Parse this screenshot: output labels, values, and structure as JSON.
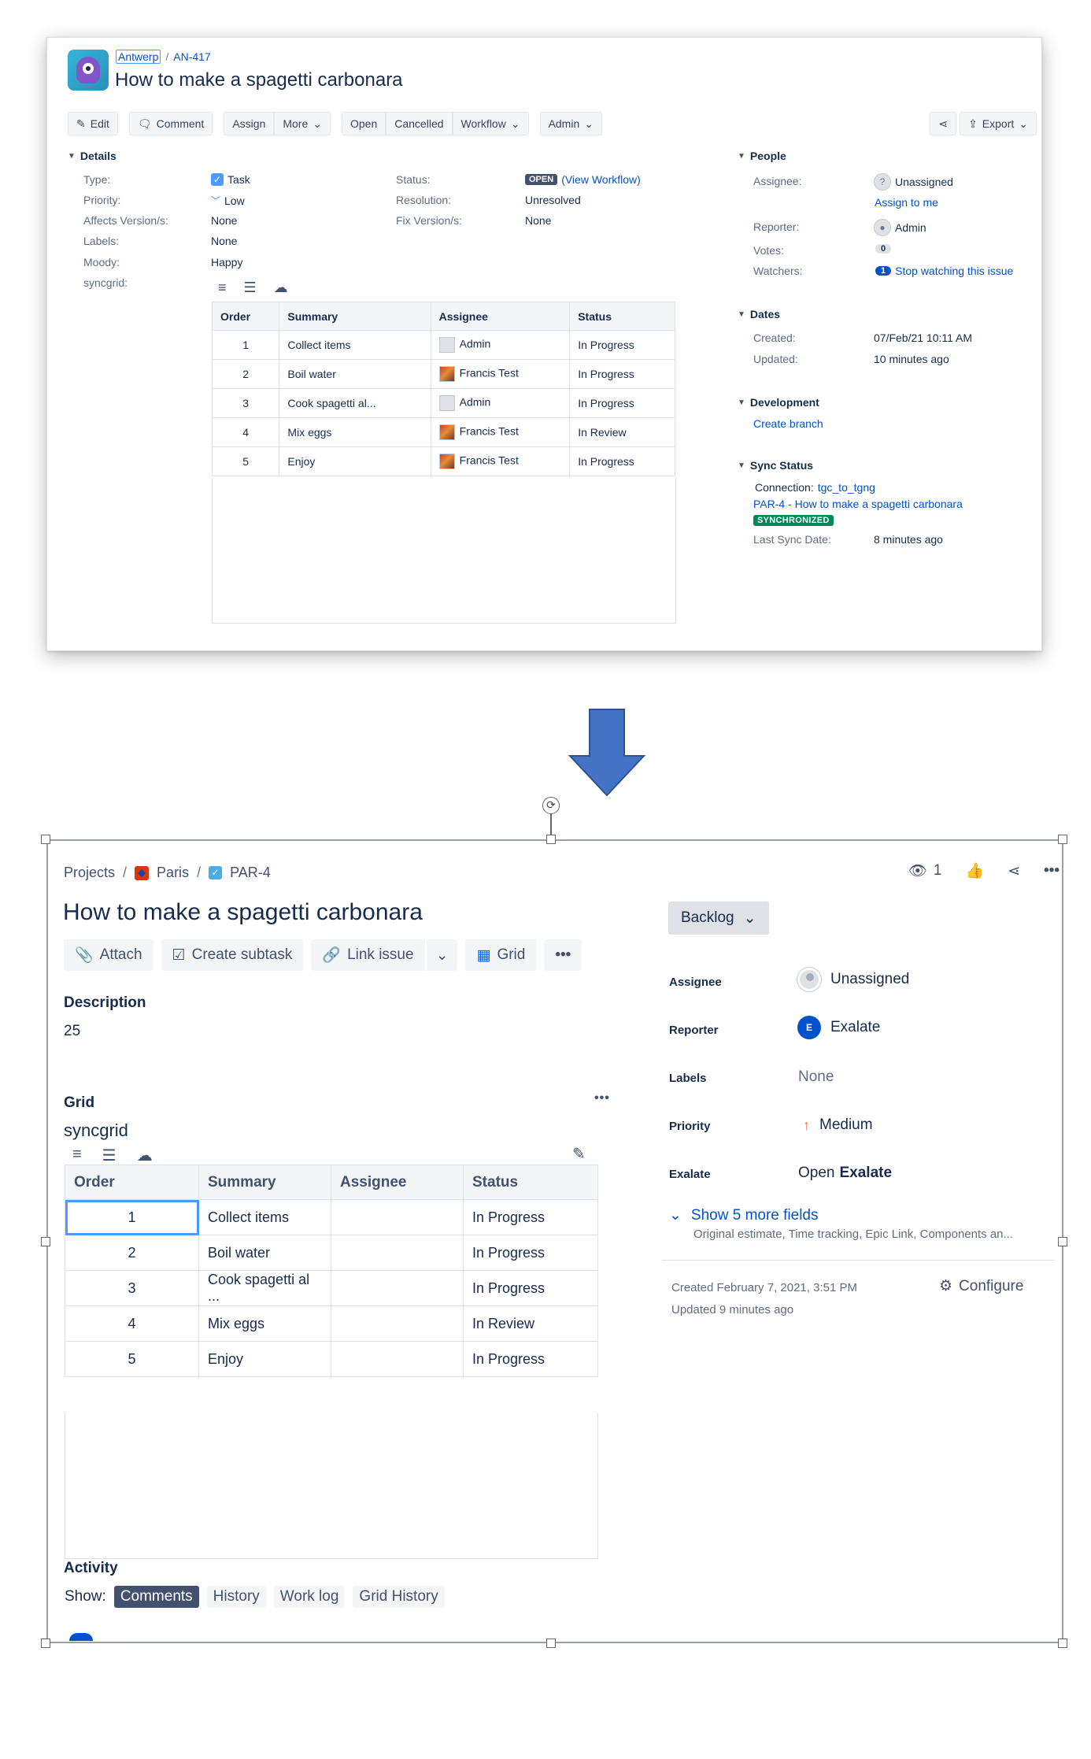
{
  "top": {
    "breadcrumb": {
      "project": "Antwerp",
      "issue_key": "AN-417"
    },
    "title": "How to make a spagetti carbonara",
    "toolbar": {
      "edit": "Edit",
      "comment": "Comment",
      "assign": "Assign",
      "more": "More",
      "open": "Open",
      "cancelled": "Cancelled",
      "workflow": "Workflow",
      "admin": "Admin",
      "export": "Export"
    },
    "details": {
      "heading": "Details",
      "type_label": "Type:",
      "type_value": "Task",
      "priority_label": "Priority:",
      "priority_value": "Low",
      "affects_label": "Affects Version/s:",
      "affects_value": "None",
      "labels_label": "Labels:",
      "labels_value": "None",
      "moody_label": "Moody:",
      "moody_value": "Happy",
      "syncgrid_label": "syncgrid:",
      "status_label": "Status:",
      "status_value": "OPEN",
      "view_workflow": "(View Workflow)",
      "resolution_label": "Resolution:",
      "resolution_value": "Unresolved",
      "fix_label": "Fix Version/s:",
      "fix_value": "None"
    },
    "grid": {
      "headers": [
        "Order",
        "Summary",
        "Assignee",
        "Status"
      ],
      "rows": [
        {
          "order": "1",
          "summary": "Collect items",
          "assignee": "Admin",
          "status": "In Progress"
        },
        {
          "order": "2",
          "summary": "Boil water",
          "assignee": "Francis Test",
          "status": "In Progress"
        },
        {
          "order": "3",
          "summary": "Cook spagetti al...",
          "assignee": "Admin",
          "status": "In Progress"
        },
        {
          "order": "4",
          "summary": "Mix eggs",
          "assignee": "Francis Test",
          "status": "In Review"
        },
        {
          "order": "5",
          "summary": "Enjoy",
          "assignee": "Francis Test",
          "status": "In Progress"
        }
      ]
    },
    "people": {
      "heading": "People",
      "assignee_label": "Assignee:",
      "assignee_value": "Unassigned",
      "assign_to_me": "Assign to me",
      "reporter_label": "Reporter:",
      "reporter_value": "Admin",
      "votes_label": "Votes:",
      "votes_value": "0",
      "watchers_label": "Watchers:",
      "watchers_count": "1",
      "watchers_link": "Stop watching this issue"
    },
    "dates": {
      "heading": "Dates",
      "created_label": "Created:",
      "created_value": "07/Feb/21 10:11 AM",
      "updated_label": "Updated:",
      "updated_value": "10 minutes ago"
    },
    "development": {
      "heading": "Development",
      "create_branch": "Create branch"
    },
    "sync": {
      "heading": "Sync Status",
      "connection_label": "Connection:",
      "connection_value": "tgc_to_tgng",
      "remote_issue": "PAR-4 - How to make a spagetti carbonara",
      "status": "SYNCHRONIZED",
      "last_sync_label": "Last Sync Date:",
      "last_sync_value": "8 minutes ago"
    }
  },
  "bottom": {
    "breadcrumb": {
      "projects": "Projects",
      "project": "Paris",
      "issue_key": "PAR-4"
    },
    "watch_count": "1",
    "title": "How to make a spagetti carbonara",
    "toolbar": {
      "attach": "Attach",
      "create_subtask": "Create subtask",
      "link_issue": "Link issue",
      "grid": "Grid"
    },
    "description_heading": "Description",
    "description_value": "25",
    "grid_heading": "Grid",
    "syncgrid_label": "syncgrid",
    "grid": {
      "headers": [
        "Order",
        "Summary",
        "Assignee",
        "Status"
      ],
      "rows": [
        {
          "order": "1",
          "summary": "Collect items",
          "assignee": "",
          "status": "In Progress"
        },
        {
          "order": "2",
          "summary": "Boil water",
          "assignee": "",
          "status": "In Progress"
        },
        {
          "order": "3",
          "summary": "Cook spagetti al ...",
          "assignee": "",
          "status": "In Progress"
        },
        {
          "order": "4",
          "summary": "Mix eggs",
          "assignee": "",
          "status": "In Review"
        },
        {
          "order": "5",
          "summary": "Enjoy",
          "assignee": "",
          "status": "In Progress"
        }
      ]
    },
    "activity": {
      "heading": "Activity",
      "show_label": "Show:",
      "tabs": [
        "Comments",
        "History",
        "Work log",
        "Grid History"
      ]
    },
    "status_button": "Backlog",
    "fields": {
      "assignee_label": "Assignee",
      "assignee_value": "Unassigned",
      "reporter_label": "Reporter",
      "reporter_value": "Exalate",
      "reporter_initial": "E",
      "labels_label": "Labels",
      "labels_value": "None",
      "priority_label": "Priority",
      "priority_value": "Medium",
      "exalate_label": "Exalate",
      "exalate_value_prefix": "Open",
      "exalate_value_bold": "Exalate"
    },
    "show_more": "Show 5 more fields",
    "show_more_sub": "Original estimate, Time tracking, Epic Link, Components an...",
    "created": "Created February 7, 2021, 3:51 PM",
    "updated": "Updated 9 minutes ago",
    "configure": "Configure"
  },
  "colors": {
    "accent": "#0052cc",
    "synchronized": "#00875a",
    "arrow": "#4472c4"
  }
}
